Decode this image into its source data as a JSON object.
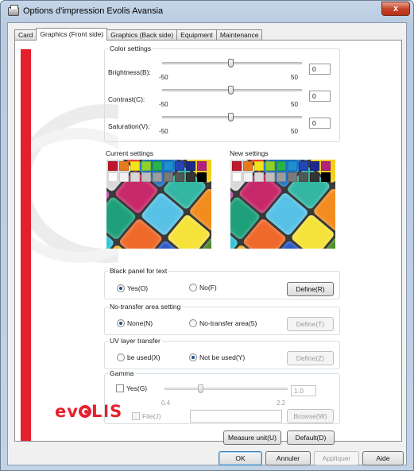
{
  "window": {
    "title": "Options d'impression Evolis Avansia",
    "close_label": "x"
  },
  "tabs": [
    {
      "label": "Card",
      "active": false
    },
    {
      "label": "Graphics (Front side)",
      "active": true
    },
    {
      "label": "Graphics (Back side)",
      "active": false
    },
    {
      "label": "Equipment",
      "active": false
    },
    {
      "label": "Maintenance",
      "active": false
    }
  ],
  "color_settings": {
    "title": "Color settings",
    "brightness": {
      "label": "Brightness(B):",
      "min_label": "-50",
      "max_label": "50",
      "value": "0"
    },
    "contrast": {
      "label": "Contrast(C):",
      "min_label": "-50",
      "max_label": "50",
      "value": "0"
    },
    "saturation": {
      "label": "Saturation(V):",
      "min_label": "-50",
      "max_label": "50",
      "value": "0"
    }
  },
  "previews": {
    "current_label": "Current settings",
    "new_label": "New settings"
  },
  "black_panel": {
    "title": "Black panel for text",
    "yes_label": "Yes(O)",
    "no_label": "No(F)",
    "selected": "yes",
    "define_label": "Define(R)"
  },
  "no_transfer": {
    "title": "No-transfer area setting",
    "none_label": "None(N)",
    "area_label": "No-transfer area(5)",
    "selected": "none",
    "define_label": "Define(T)"
  },
  "uv_layer": {
    "title": "UV layer transfer",
    "used_label": "be used(X)",
    "not_used_label": "Not be used(Y)",
    "selected": "not_used",
    "define_label": "Define(Z)"
  },
  "gamma": {
    "title": "Gamma",
    "yes_label": "Yes(G)",
    "min_label": "0.4",
    "max_label": "2.2",
    "value": "1.0",
    "file_label": "File(J)",
    "browse_label": "Browse(W)"
  },
  "bottom_buttons": {
    "measure_label": "Measure unit(U)",
    "default_label": "Default(D)"
  },
  "dialog_buttons": {
    "ok_label": "OK",
    "cancel_label": "Annuler",
    "apply_label": "Appliquer",
    "help_label": "Aide"
  },
  "brand": {
    "logo_text": "evolis",
    "accent_color": "#e5202e"
  },
  "swatch_colors": [
    "#c0162b",
    "#e87a1e",
    "#f4e21a",
    "#8fd12b",
    "#27b24a",
    "#1f8fd3",
    "#2246b6",
    "#1d2a88",
    "#b0237c",
    "#ffffff",
    "#f1f1f1",
    "#d8d8d8",
    "#bfbfbf",
    "#9c9c9c",
    "#7a7a7a",
    "#555555",
    "#333333",
    "#000000"
  ],
  "chalk_colors": [
    "#e84b8a",
    "#2aa0d8",
    "#f2cf1c",
    "#6ac24a",
    "#8a3fb0",
    "#e6372b",
    "#1c6fc4",
    "#33b6a4",
    "#f28c1e",
    "#3f3faa",
    "#d9d9d9",
    "#c7286a",
    "#58c2e6",
    "#f5e33a",
    "#4a8c2a",
    "#b73aa8",
    "#1ea07a",
    "#ef6a2a",
    "#2c58c8",
    "#e2e2e2",
    "#9a2ab3",
    "#2ec4d8",
    "#f0b218",
    "#e13f7a",
    "#5a9ee0"
  ]
}
